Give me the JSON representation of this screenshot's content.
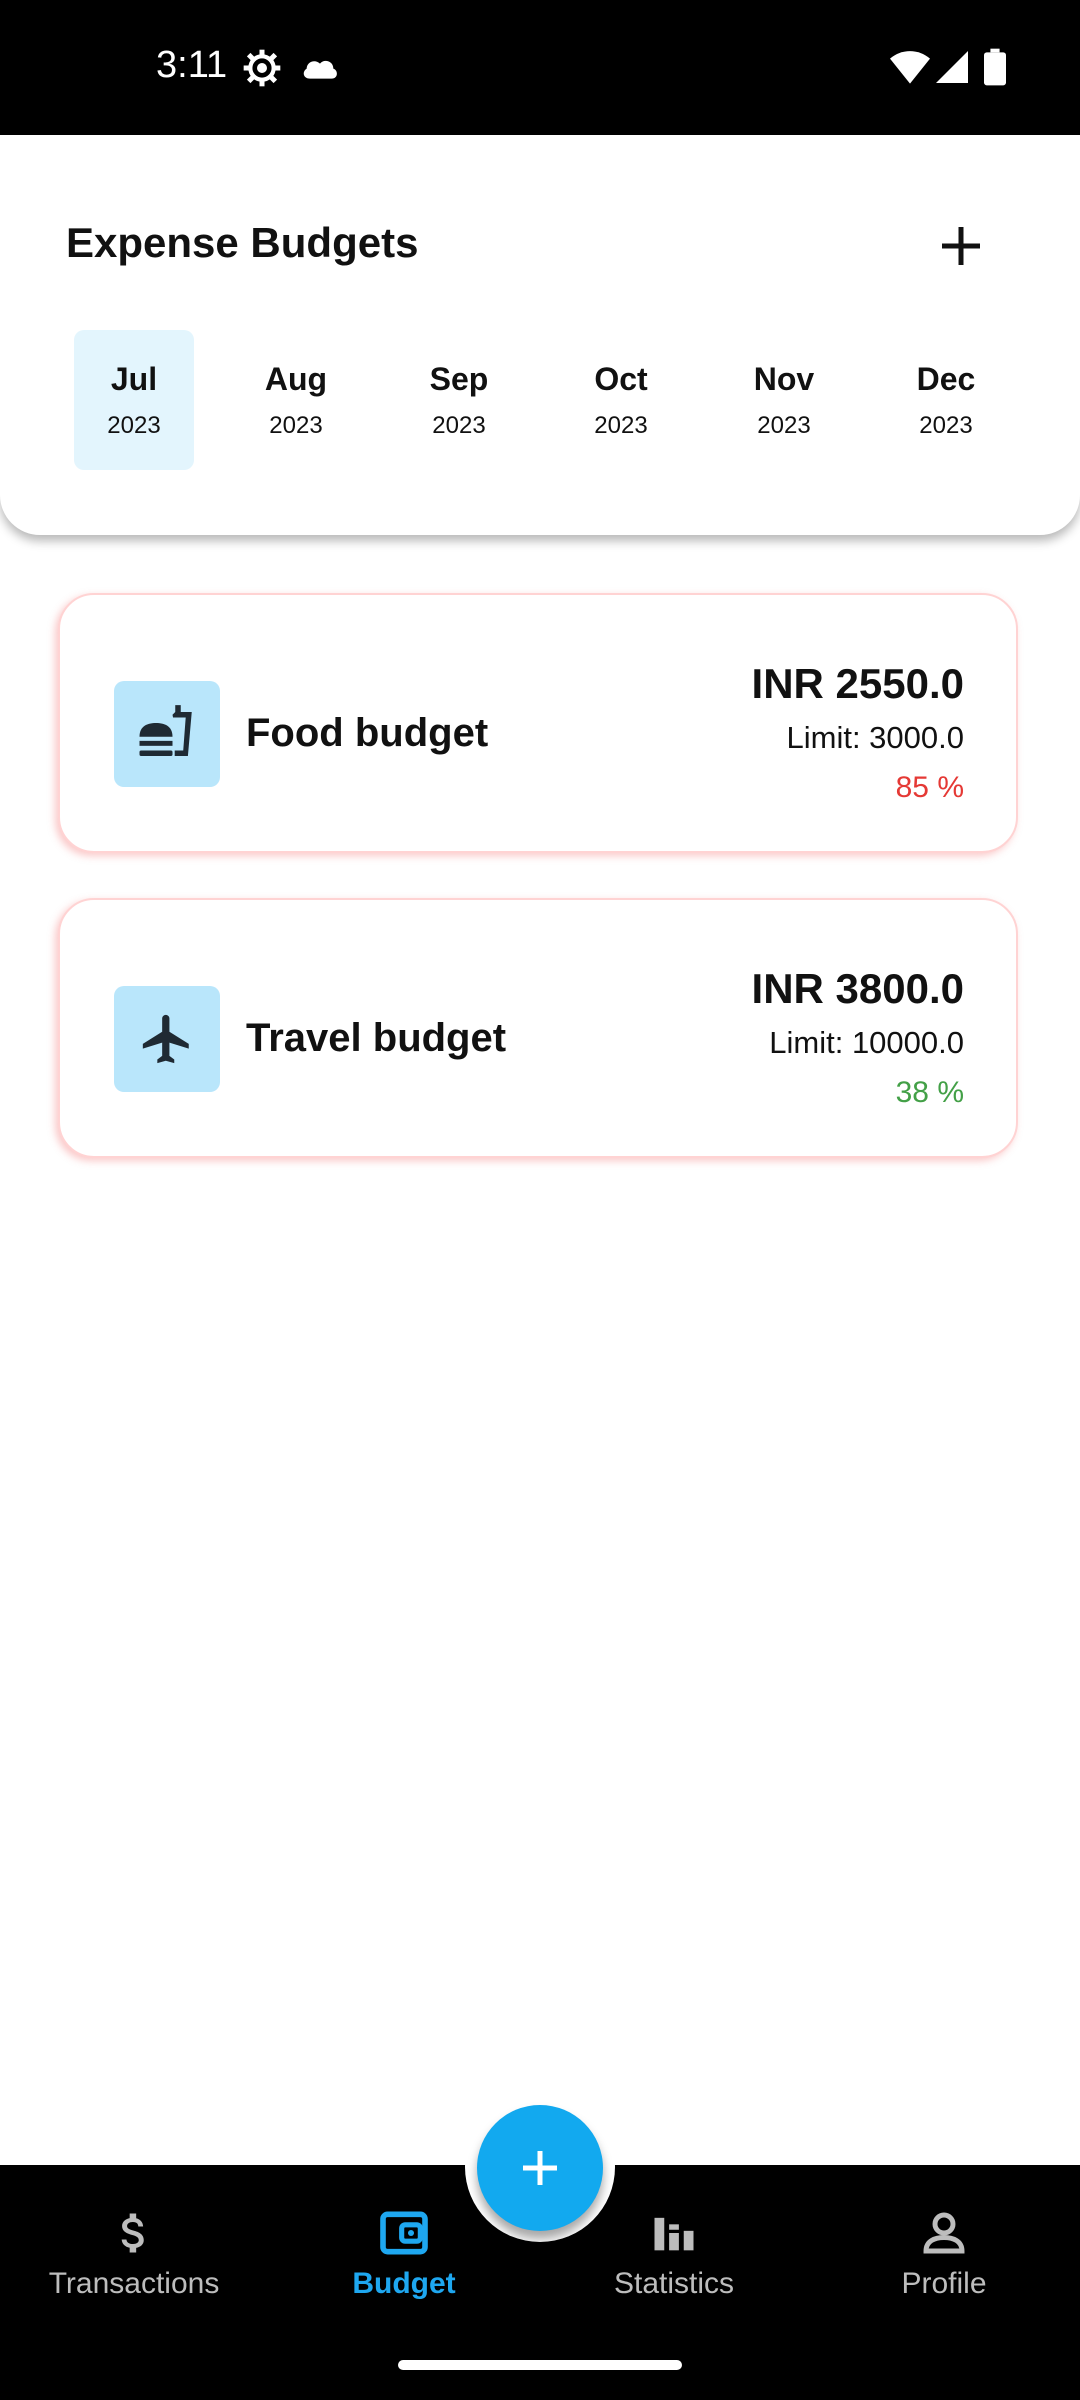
{
  "status_bar": {
    "time": "3:11",
    "left_icons": [
      "settings-gear-icon",
      "cloud-icon"
    ],
    "right_icons": [
      "wifi-icon",
      "cell-signal-icon",
      "battery-icon"
    ]
  },
  "header": {
    "title": "Expense Budgets",
    "add_icon": "plus-icon"
  },
  "months": [
    {
      "name": "Jul",
      "year": "2023",
      "selected": true
    },
    {
      "name": "Aug",
      "year": "2023"
    },
    {
      "name": "Sep",
      "year": "2023"
    },
    {
      "name": "Oct",
      "year": "2023"
    },
    {
      "name": "Nov",
      "year": "2023"
    },
    {
      "name": "Dec",
      "year": "2023"
    }
  ],
  "budgets": [
    {
      "name": "Food budget",
      "icon": "fastfood-icon",
      "amount": "INR 2550.0",
      "limit": "Limit: 3000.0",
      "percent": "85 %",
      "percent_value": 85,
      "percent_color": "#e53935"
    },
    {
      "name": "Travel budget",
      "icon": "airplane-icon",
      "amount": "INR 3800.0",
      "limit": "Limit: 10000.0",
      "percent": "38 %",
      "percent_value": 38,
      "percent_color": "#43a047"
    }
  ],
  "bottom_nav": {
    "items": [
      {
        "label": "Transactions",
        "icon": "dollar-icon"
      },
      {
        "label": "Budget",
        "icon": "wallet-icon",
        "active": true
      },
      {
        "label": "Statistics",
        "icon": "bar-chart-icon"
      },
      {
        "label": "Profile",
        "icon": "person-icon"
      }
    ],
    "fab_icon": "plus-icon"
  },
  "colors": {
    "accent": "#12a9ef",
    "selected_month_bg": "#e3f5fd",
    "icon_box_bg": "#b9e6fb",
    "over_budget": "#e53935",
    "under_budget": "#43a047"
  }
}
